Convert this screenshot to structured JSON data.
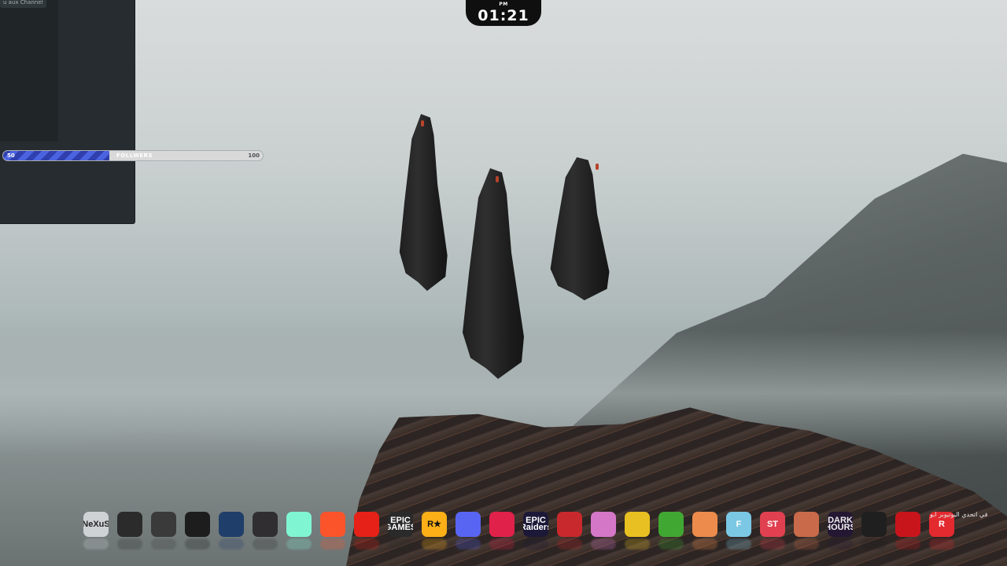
{
  "clock": {
    "ampm": "PM",
    "time": "01:21"
  },
  "panel": {
    "label": "u aux Channel"
  },
  "followers": {
    "min": "50",
    "max": "100",
    "label": "FOLLWERS",
    "progress_fraction": 0.41
  },
  "dock": {
    "items": [
      {
        "name": "nexus-icon",
        "text": "NeXuS",
        "bg": "#cfd2d4",
        "fg": "#222"
      },
      {
        "name": "target-icon",
        "text": "",
        "bg": "#2b2b2b",
        "fg": "#e85b2a"
      },
      {
        "name": "power-gradient-icon",
        "text": "",
        "bg": "#3a3a3a",
        "fg": "#9ad"
      },
      {
        "name": "nvidia-icon",
        "text": "",
        "bg": "#1d1d1d",
        "fg": "#76b900"
      },
      {
        "name": "camera-app-icon",
        "text": "",
        "bg": "#1f3e6a",
        "fg": "#fff"
      },
      {
        "name": "obs-icon",
        "text": "",
        "bg": "#302e31",
        "fg": "#ddd"
      },
      {
        "name": "streamlabs-icon",
        "text": "",
        "bg": "#80f5d2",
        "fg": "#09161d"
      },
      {
        "name": "brave-icon",
        "text": "",
        "bg": "#fb542b",
        "fg": "#fff"
      },
      {
        "name": "youtube-icon",
        "text": "",
        "bg": "#e62117",
        "fg": "#fff"
      },
      {
        "name": "epic-games-icon",
        "text": "EPIC GAMES",
        "bg": "#2a2a2a",
        "fg": "#fff"
      },
      {
        "name": "rockstar-icon",
        "text": "R★",
        "bg": "#fcaf17",
        "fg": "#111"
      },
      {
        "name": "discord-icon",
        "text": "",
        "bg": "#5865f2",
        "fg": "#fff"
      },
      {
        "name": "apex-icon",
        "text": "",
        "bg": "#e0214a",
        "fg": "#fff"
      },
      {
        "name": "epic-raiders-icon",
        "text": "EPIC Raiders",
        "bg": "#1b1838",
        "fg": "#fff"
      },
      {
        "name": "zombie-game-icon",
        "text": "",
        "bg": "#c8292c",
        "fg": "#fff"
      },
      {
        "name": "pink-pattern-icon",
        "text": "",
        "bg": "#d477c7",
        "fg": "#fff"
      },
      {
        "name": "robot-game-icon",
        "text": "",
        "bg": "#e8c021",
        "fg": "#1a1a1a"
      },
      {
        "name": "minecraft-icon",
        "text": "",
        "bg": "#40a832",
        "fg": "#111"
      },
      {
        "name": "twitch-orange-icon",
        "text": "",
        "bg": "#ec8b4b",
        "fg": "#fff"
      },
      {
        "name": "f-app-icon",
        "text": "F",
        "bg": "#7bc8e5",
        "fg": "#fff"
      },
      {
        "name": "st-icon",
        "text": "ST",
        "bg": "#e04050",
        "fg": "#fff"
      },
      {
        "name": "character-game-icon",
        "text": "",
        "bg": "#c96a4a",
        "fg": "#fff"
      },
      {
        "name": "dark-hours-icon",
        "text": "DARK HOURS",
        "bg": "#241733",
        "fg": "#eee"
      },
      {
        "name": "dark-game-icon",
        "text": "",
        "bg": "#1f1f1f",
        "fg": "#fc6"
      },
      {
        "name": "among-us-icon",
        "text": "",
        "bg": "#c8151b",
        "fg": "#9ee"
      },
      {
        "name": "roblox-icon",
        "text": "R",
        "bg": "#e32a2f",
        "fg": "#fff"
      }
    ]
  },
  "arabic_caption": "في اتحدي اليوتيوبر ابو"
}
